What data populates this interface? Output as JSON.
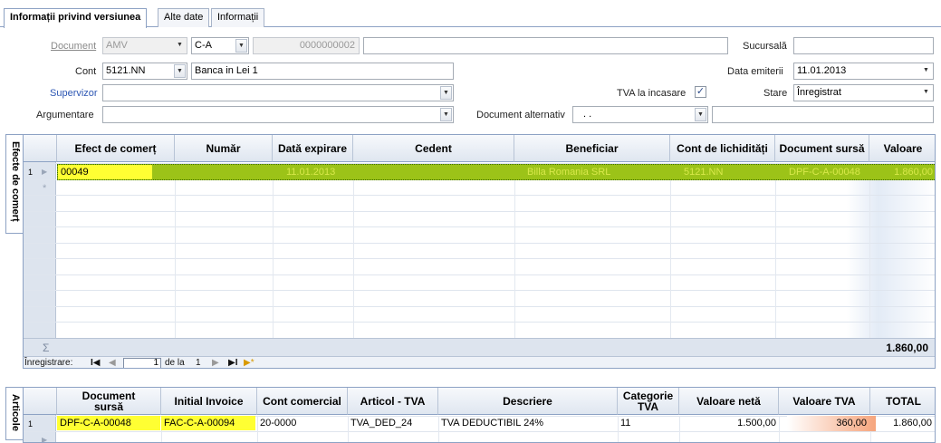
{
  "tabs": [
    {
      "label": "Informații privind versiunea"
    },
    {
      "label": "Alte date"
    },
    {
      "label": "Informații"
    }
  ],
  "form": {
    "document_label": "Document",
    "document_type": "AMV",
    "document_series": "C-A",
    "document_number": "0000000002",
    "sucursala_label": "Sucursală",
    "sucursala_value": "",
    "cont_label": "Cont",
    "cont_value": "5121.NN",
    "cont_description": "Banca in Lei 1",
    "data_emiterii_label": "Data emiterii",
    "data_emiterii_value": "11.01.2013",
    "supervizor_label": "Supervizor",
    "supervizor_value": "",
    "tva_label": "TVA la incasare",
    "tva_checked": "✓",
    "stare_label": "Stare",
    "stare_value": "Înregistrat",
    "argumentare_label": "Argumentare",
    "argumentare_value": "",
    "doc_alt_label": "Document alternativ",
    "doc_alt_value": ".     .",
    "doc_alt_extra": ""
  },
  "grid1": {
    "side_tab": "Efecte de comerț",
    "columns": [
      "Efect de comerț",
      "Număr",
      "Dată expirare",
      "Cedent",
      "Beneficiar",
      "Cont de lichidități",
      "Document sursă",
      "Valoare"
    ],
    "rows": [
      {
        "index": "1",
        "cells": [
          "00049",
          "",
          "11.01.2013",
          "",
          "Billa Romania SRL",
          "5121.NN",
          "DPF-C-A-00048",
          "1.860,00"
        ]
      }
    ],
    "sigma": "Σ",
    "total": "1.860,00",
    "new_row_marker": "*",
    "nav": {
      "label": "Înregistrare:",
      "first": "I◀",
      "prev": "◀",
      "current": "1",
      "of": "de la",
      "count": "1",
      "next": "▶",
      "last": "▶I",
      "add": "▶*"
    }
  },
  "grid2": {
    "side_tab": "Articole",
    "columns": [
      "Document sursă",
      "Initial Invoice",
      "Cont comercial",
      "Articol - TVA",
      "Descriere",
      "Categorie TVA",
      "Valoare netă",
      "Valoare TVA",
      "TOTAL"
    ],
    "rows": [
      {
        "index": "1",
        "cells": [
          "DPF-C-A-00048",
          "FAC-C-A-00094",
          "20-0000",
          "TVA_DED_24",
          "TVA DEDUCTIBIL 24%",
          "11",
          "1.500,00",
          "360,00",
          "1.860,00"
        ]
      }
    ]
  },
  "colors": {
    "accent_border": "#8da2c4",
    "highlight_yellow": "#ffff33",
    "row_green": "#9cc318",
    "row_text": "#d8e84a",
    "link_blue": "#2c56b3",
    "vat_orange": "#f6a57d"
  }
}
